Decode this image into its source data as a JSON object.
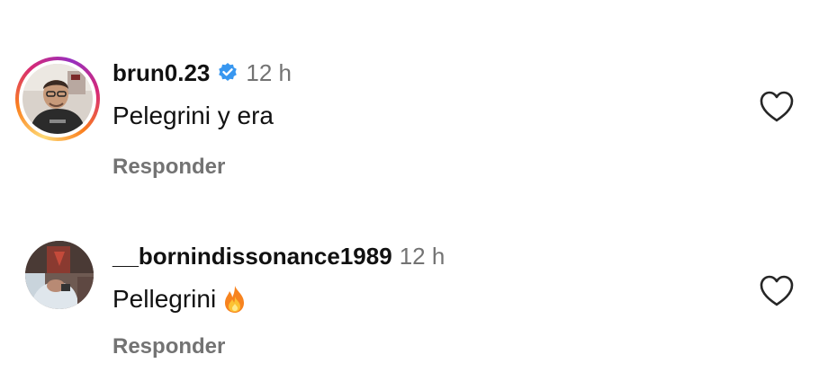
{
  "comments": [
    {
      "username": "brun0.23",
      "verified": true,
      "time": "12 h",
      "text": "Pelegrini y era",
      "reply_label": "Responder",
      "like_icon": "heart-outline-icon",
      "has_story_ring": true
    },
    {
      "username": "__bornindissonance1989",
      "verified": false,
      "time": "12 h",
      "text": "Pellegrini",
      "emoji": "fire-emoji",
      "reply_label": "Responder",
      "like_icon": "heart-outline-icon",
      "has_story_ring": false
    }
  ],
  "colors": {
    "verified_badge": "#3897f0",
    "muted_text": "#737373",
    "text": "#111111"
  }
}
